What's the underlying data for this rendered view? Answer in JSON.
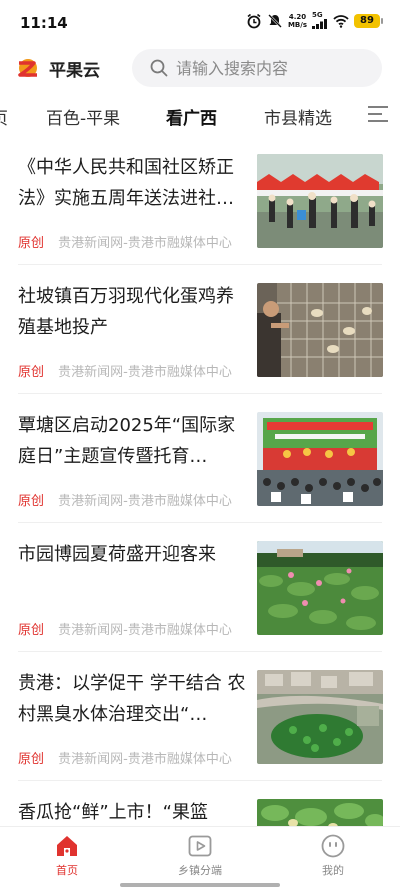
{
  "status_bar": {
    "time": "11:14",
    "net_speed_value": "4.20",
    "net_speed_unit": "MB/s",
    "network": "5G",
    "battery": "89",
    "icons": [
      "alarm-icon",
      "mute-icon",
      "signal-icon",
      "wifi-icon",
      "battery-icon"
    ]
  },
  "header": {
    "app_name": "平果云",
    "search_placeholder": "请输入搜索内容",
    "accent_color": "#e0332f"
  },
  "tabs": {
    "items": [
      {
        "label": "页"
      },
      {
        "label": "百色-平果"
      },
      {
        "label": "看广西",
        "active": true
      },
      {
        "label": "市县精选"
      }
    ]
  },
  "news": {
    "items": [
      {
        "title": "《中华人民共和国社区矫正法》实施五周年送法进社…",
        "badge": "原创",
        "source": "贵港新闻网-贵港市融媒体中心",
        "thumb": "market-tents-crowd-image"
      },
      {
        "title": "社坡镇百万羽现代化蛋鸡养殖基地投产",
        "badge": "原创",
        "source": "贵港新闻网-贵港市融媒体中心",
        "thumb": "poultry-farm-cages-image"
      },
      {
        "title": "覃塘区启动2025年“国际家庭日”主题宣传暨托育…",
        "badge": "原创",
        "source": "贵港新闻网-贵港市融媒体中心",
        "thumb": "stage-event-audience-image"
      },
      {
        "title": "市园博园夏荷盛开迎客来",
        "badge": "原创",
        "source": "贵港新闻网-贵港市融媒体中心",
        "thumb": "lotus-pond-image"
      },
      {
        "title": "贵港：以学促干 学干结合 农村黑臭水体治理交出“…",
        "badge": "原创",
        "source": "贵港新闻网-贵港市融媒体中心",
        "thumb": "aerial-village-pond-image"
      },
      {
        "title": "香瓜抢“鲜”上市！“果篮",
        "badge": "",
        "source": "",
        "thumb": "melon-field-image"
      }
    ]
  },
  "bottom_nav": {
    "items": [
      {
        "label": "首页",
        "icon": "home-icon",
        "active": true
      },
      {
        "label": "乡镇分端",
        "icon": "play-icon"
      },
      {
        "label": "我的",
        "icon": "profile-face-icon"
      }
    ]
  }
}
